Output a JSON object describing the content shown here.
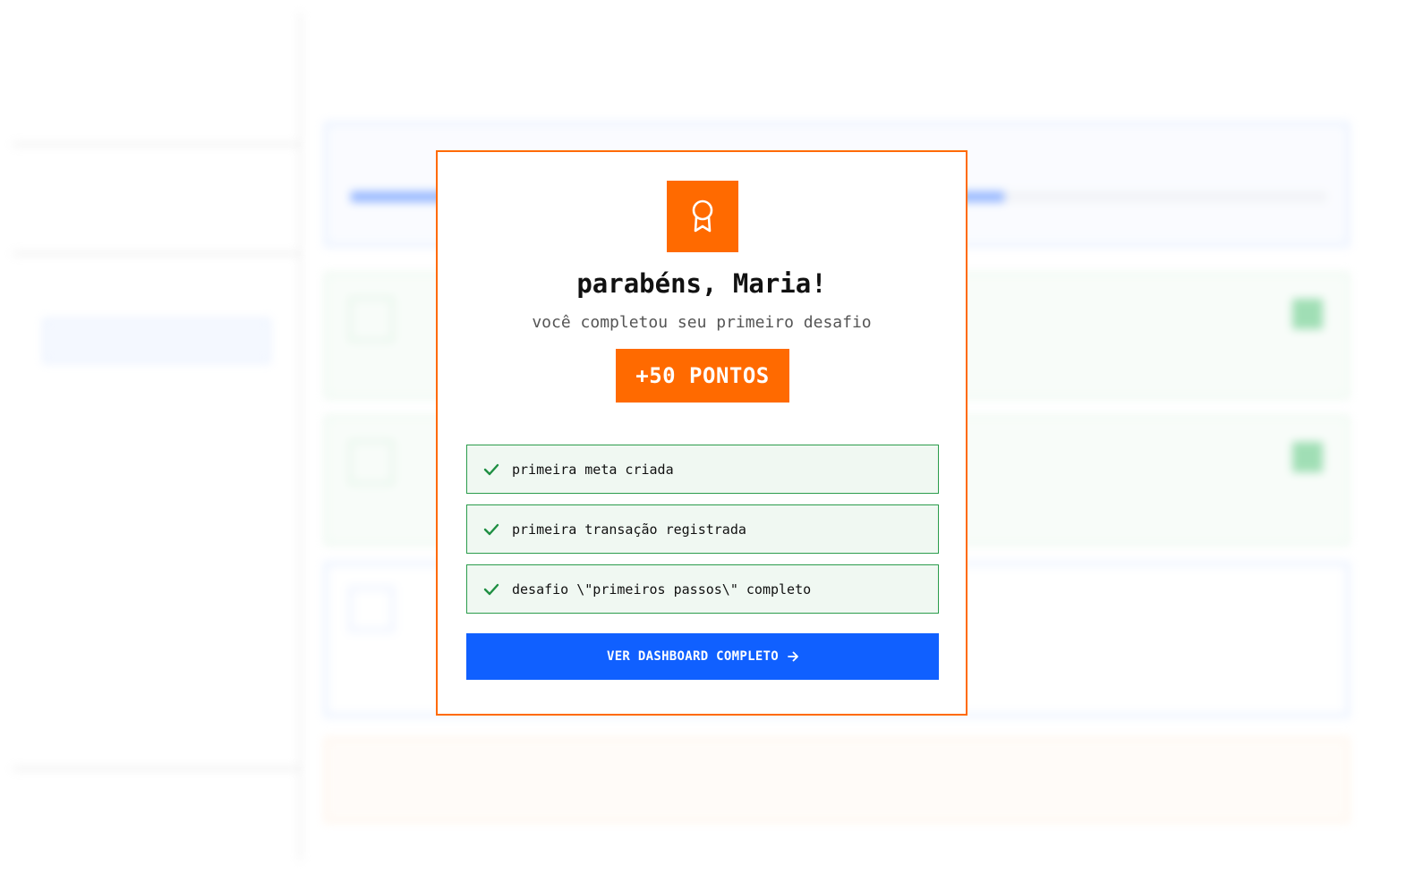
{
  "modal": {
    "title": "parabéns, Maria!",
    "subtitle": "você completou seu primeiro desafio",
    "points_label": "+50 PONTOS",
    "achievements": [
      {
        "label": "primeira meta criada",
        "status": "check-icon"
      },
      {
        "label": "primeira transação registrada",
        "status": "check-icon"
      },
      {
        "label": "desafio \\\"primeiros passos\\\" completo",
        "status": "check-icon"
      }
    ],
    "cta_label": "VER DASHBOARD COMPLETO",
    "icon": "award-icon"
  },
  "colors": {
    "accent_orange": "#ff6a00",
    "primary_blue": "#1060ff",
    "success_green": "#2b9c4c",
    "success_bg": "#f0f8f2"
  }
}
